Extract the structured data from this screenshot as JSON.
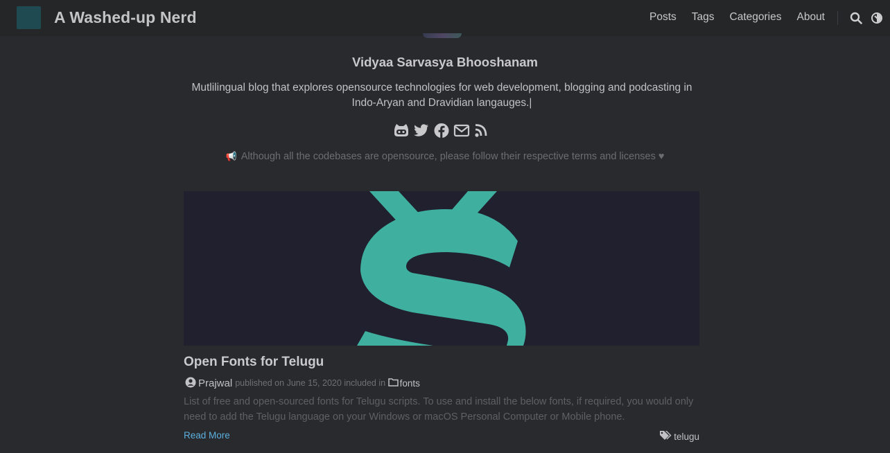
{
  "header": {
    "site_title": "A Washed-up Nerd",
    "nav": [
      {
        "label": "Posts"
      },
      {
        "label": "Tags"
      },
      {
        "label": "Categories"
      },
      {
        "label": "About"
      }
    ],
    "icons": [
      "search-icon",
      "theme-toggle-icon"
    ]
  },
  "profile": {
    "name": "Vidyaa Sarvasya Bhooshanam",
    "bio": "Mutlilingual blog that explores opensource technologies for web development, blogging and podcasting in Indo-Aryan and Dravidian langauges.|",
    "social_icons": [
      "github-icon",
      "twitter-icon",
      "facebook-icon",
      "email-icon",
      "rss-icon"
    ]
  },
  "notice": {
    "icon": "megaphone-icon",
    "text": "Although all the codebases are opensource, please follow their respective terms and licenses",
    "heart": "♥"
  },
  "post": {
    "title": "Open Fonts for Telugu",
    "author": "Prajwal",
    "published_prefix": "published on",
    "date": "June 15, 2020",
    "included_in": "included in",
    "category": "fonts",
    "summary": "List of free and open-sourced fonts for Telugu scripts. To use and install the below fonts, if required, you would only need to add the Telugu language on your Windows or macOS Personal Computer or Mobile phone.",
    "read_more": "Read More",
    "tag": "telugu"
  },
  "colors": {
    "background": "#292a2d",
    "header": "#252627",
    "accent_teal": "#3fb0a0",
    "link": "#5bb0e0"
  }
}
